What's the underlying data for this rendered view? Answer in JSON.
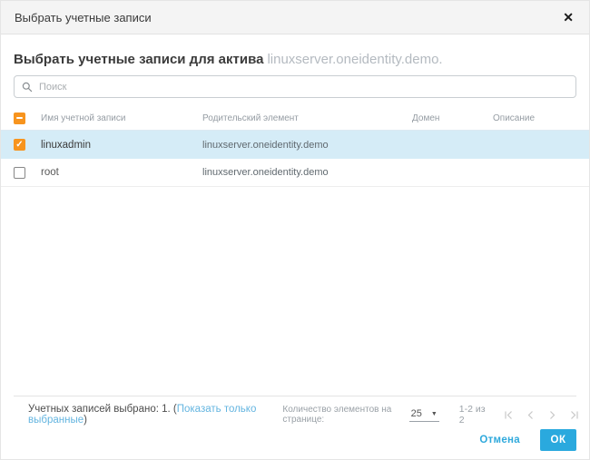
{
  "dialog": {
    "title": "Выбрать учетные записи"
  },
  "icons": {
    "close": "✕",
    "check": "✓",
    "caret": "▼"
  },
  "heading": {
    "prefix": "Выбрать учетные записи для актива",
    "asset": "linuxserver.oneidentity.demo."
  },
  "search": {
    "placeholder": "Поиск",
    "value": ""
  },
  "table": {
    "columns": [
      "Имя учетной записи",
      "Родительский элемент",
      "Домен",
      "Описание"
    ],
    "rows": [
      {
        "name": "linuxadmin",
        "parent": "linuxserver.oneidentity.demo",
        "domain": "",
        "description": ""
      },
      {
        "name": "root",
        "parent": "linuxserver.oneidentity.demo",
        "domain": "",
        "description": ""
      }
    ]
  },
  "footer": {
    "selected_prefix": "Учетных записей выбрано: 1. (",
    "show_selected_link": "Показать только выбранные",
    "selected_suffix": ")",
    "page_size_label": "Количество элементов на странице:",
    "page_size_value": "25",
    "range_text": "1-2 из 2"
  },
  "actions": {
    "cancel": "Отмена",
    "ok": "ОК"
  },
  "colors": {
    "accent": "#2aa9de",
    "checkbox_orange": "#f7941e",
    "row_highlight": "#d5ecf7",
    "link": "#64b5e0",
    "header_bg": "#f4f4f4"
  }
}
